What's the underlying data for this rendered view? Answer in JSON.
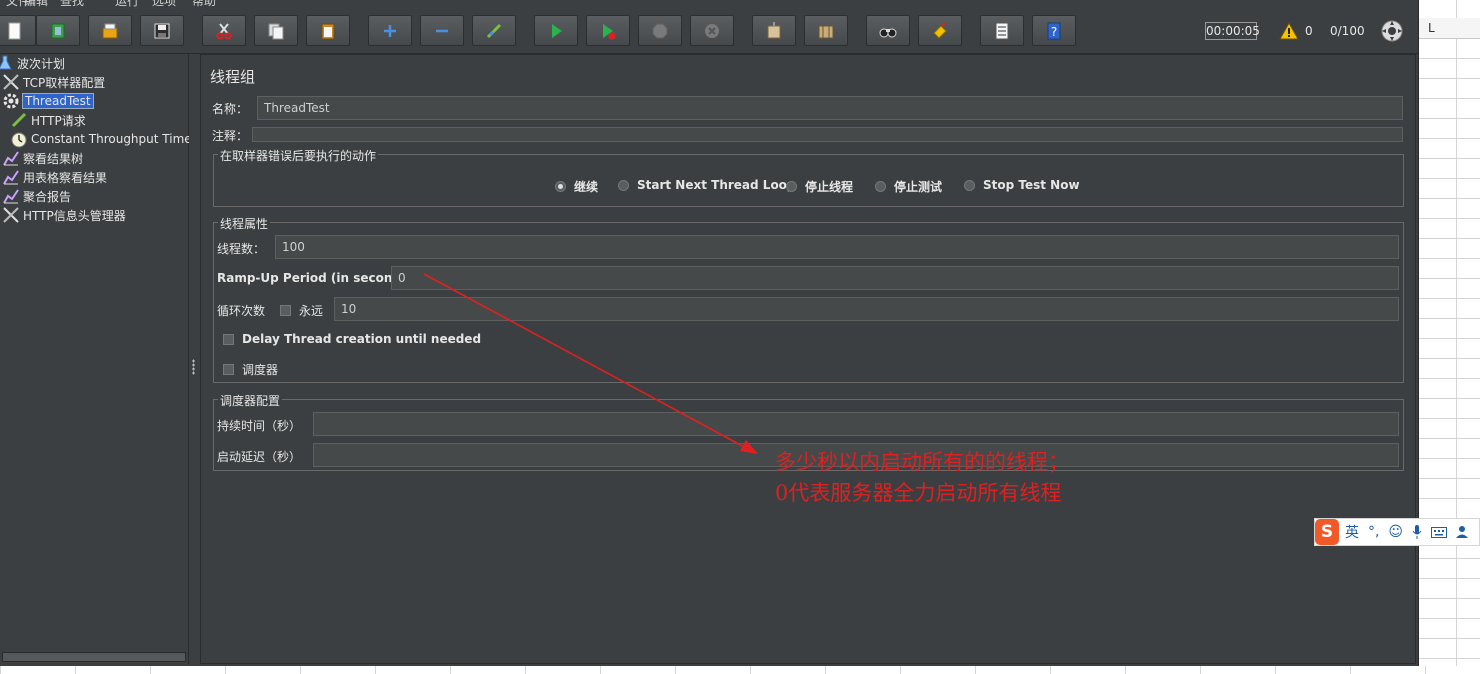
{
  "menu": [
    "文件",
    "编辑",
    "查找",
    "运行",
    "选项",
    "帮助"
  ],
  "toolbar": {
    "icons": [
      "new-icon",
      "templates-icon",
      "open-icon",
      "save-icon",
      "cut-icon",
      "copy-icon",
      "paste-icon",
      "expand-icon",
      "collapse-icon",
      "toggle-icon",
      "start-icon",
      "start-no-pause-icon",
      "stop-icon",
      "shutdown-icon",
      "clear-icon",
      "clear-all-icon",
      "search-icon",
      "reset-search-icon",
      "function-helper-icon",
      "help-icon"
    ],
    "timer": "00:00:05",
    "warning_count": "0",
    "thread_count": "0/100"
  },
  "tree": {
    "items": [
      {
        "label": "波次计划",
        "icon": "test-plan-icon"
      },
      {
        "label": "TCP取样器配置",
        "icon": "config-tool-icon"
      },
      {
        "label": "ThreadTest",
        "icon": "gear-icon",
        "selected": true
      },
      {
        "label": "HTTP请求",
        "icon": "pipette-icon"
      },
      {
        "label": "Constant Throughput Timer",
        "icon": "timer-icon"
      },
      {
        "label": "察看结果树",
        "icon": "listener-icon"
      },
      {
        "label": "用表格察看结果",
        "icon": "listener-icon"
      },
      {
        "label": "聚合报告",
        "icon": "listener-icon"
      },
      {
        "label": "HTTP信息头管理器",
        "icon": "config-tool-icon"
      }
    ]
  },
  "panel": {
    "title": "线程组",
    "name_label": "名称：",
    "name_value": "ThreadTest",
    "comment_label": "注释：",
    "error_action": {
      "title": "在取样器错误后要执行的动作",
      "options": [
        "继续",
        "Start Next Thread Loop",
        "停止线程",
        "停止测试",
        "Stop Test Now"
      ],
      "selected": 0
    },
    "thread_props": {
      "title": "线程属性",
      "threads_label": "线程数：",
      "threads_value": "100",
      "rampup_label": "Ramp-Up Period (in seconds):",
      "rampup_value": "0",
      "loop_label": "循环次数",
      "forever_label": "永远",
      "loop_value": "10",
      "delay_label": "Delay Thread creation until needed",
      "scheduler_label": "调度器"
    },
    "scheduler_config": {
      "title": "调度器配置",
      "duration_label": "持续时间（秒）",
      "delay_label": "启动延迟（秒）"
    }
  },
  "annotation": {
    "line1": "多少秒以内启动所有的的线程；",
    "line2": "0代表服务器全力启动所有线程"
  },
  "sheet": {
    "column": "L"
  },
  "ime": {
    "mode": "英"
  }
}
